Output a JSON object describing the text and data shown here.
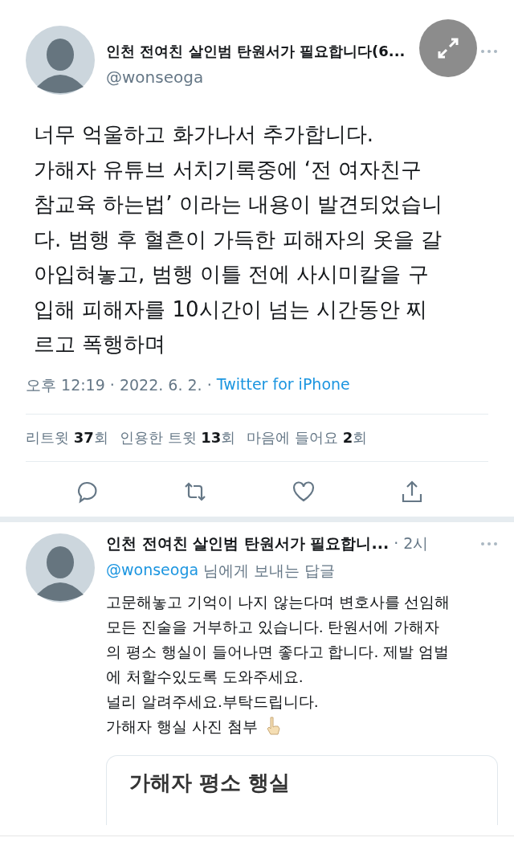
{
  "tweet": {
    "display_name": "인천 전여친 살인범 탄원서가 필요합니다(6...",
    "handle": "@wonseoga",
    "body_lines": [
      "너무 억울하고 화가나서 추가합니다.",
      "가해자 유튜브 서치기록중에 ‘전 여자친구",
      "참교육 하는법’ 이라는 내용이 발견되었습니",
      "다. 범행 후 혈흔이 가득한 피해자의 옷을 갈",
      "아입혀놓고, 범행 이틀 전에 사시미칼을 구",
      "입해 피해자를 10시간이 넘는 시간동안 찌",
      "르고 폭행하며"
    ],
    "timestamp": "오후 12:19 · 2022. 6. 2. ·",
    "source": "Twitter for iPhone",
    "stats": [
      "리트윗 **37**회",
      "인용한 트윗 **13**회",
      "마음에 들어요 **2**회"
    ]
  },
  "reply": {
    "display_name": "인천 전여친 살인범 탄원서가 필요합니...",
    "time": "· 2시",
    "handle": "@wonseoga",
    "reply_to": "님에게 보내는 답글",
    "body_lines": [
      "고문해놓고 기억이 나지 않는다며 변호사를 선임해",
      "모든 진술을 거부하고 있습니다. 탄원서에 가해자",
      "의 평소 행실이 들어나면 좋다고 합니다. 제발 엄벌",
      "에 처할수있도록 도와주세요.",
      "널리 알려주세요.부탁드립니다.",
      "가해자 행실 사진 첨부"
    ],
    "card_title": "가해자 평소 행실"
  }
}
